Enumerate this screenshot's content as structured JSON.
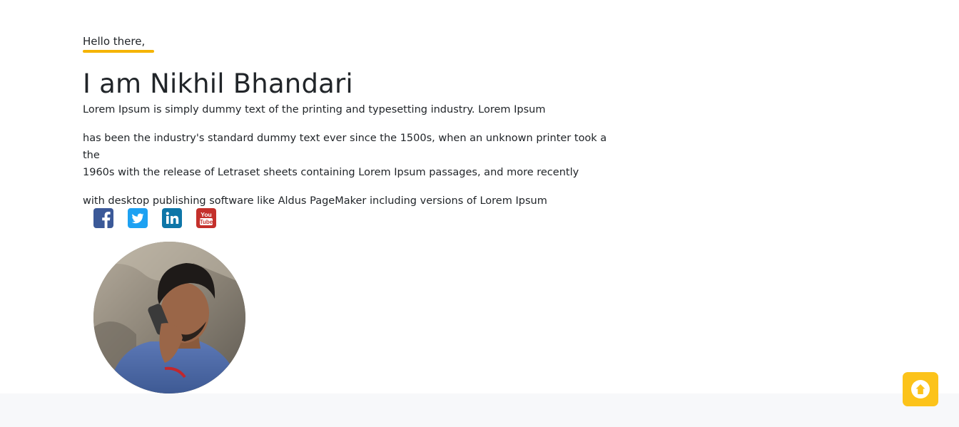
{
  "hero": {
    "greeting": "Hello there,",
    "name": "I am Nikhil Bhandari",
    "paragraph1": "Lorem Ipsum is simply dummy text of the printing and typesetting industry. Lorem Ipsum",
    "paragraph2_line1": "has been the industry's standard dummy text ever since the 1500s, when an unknown printer took a the",
    "paragraph2_line2": "1960s with the release of Letraset sheets containing Lorem Ipsum passages, and more recently",
    "paragraph3": "with desktop publishing software like Aldus PageMaker including versions of Lorem Ipsum"
  },
  "social": [
    {
      "icon": "facebook-icon",
      "color": "#3b5998"
    },
    {
      "icon": "twitter-icon",
      "color": "#1da1f2"
    },
    {
      "icon": "linkedin-icon",
      "color": "#0e76a8"
    },
    {
      "icon": "youtube-icon",
      "color": "#c4302b"
    }
  ],
  "youtube_logo_text": [
    "You",
    "Tube"
  ],
  "colors": {
    "accent": "#f5b400",
    "scroll_button": "#fcc31a",
    "footer": "#f7f8fa"
  },
  "scroll_top": {
    "icon": "arrow-up-circle-icon"
  }
}
